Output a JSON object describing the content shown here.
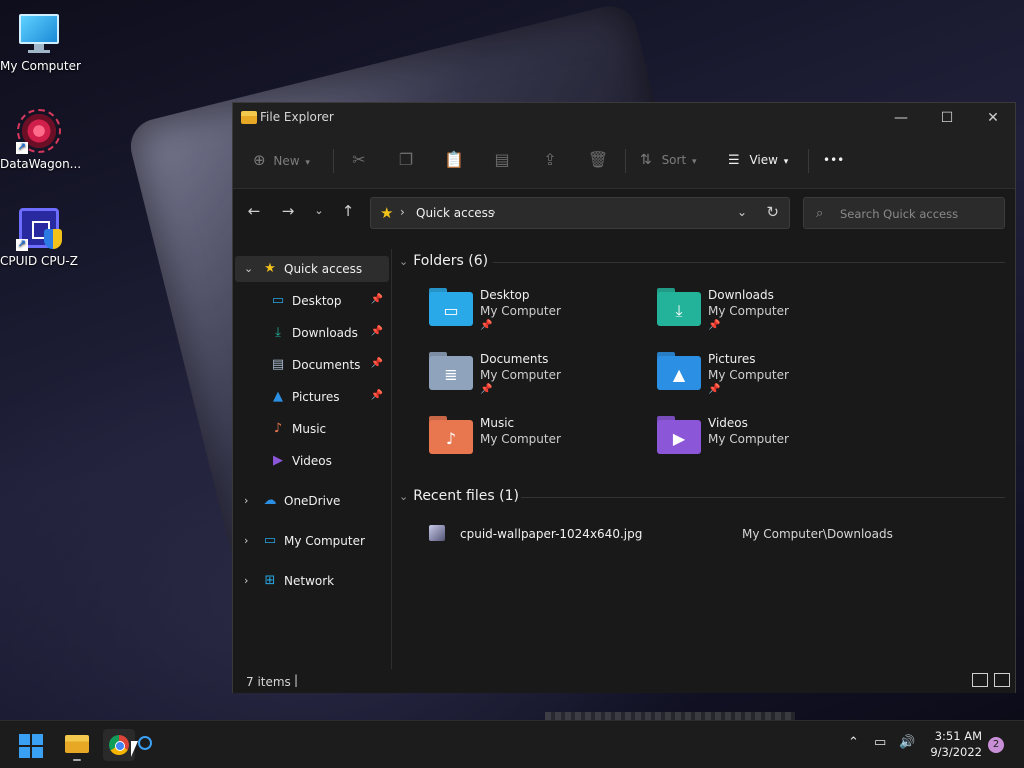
{
  "desktop": {
    "icons": [
      {
        "label": "My Computer"
      },
      {
        "label": "DataWagon..."
      },
      {
        "label": "CPUID CPU-Z"
      }
    ]
  },
  "window": {
    "title": "File Explorer",
    "controls": {
      "minimize": "—",
      "maximize": "☐",
      "close": "✕"
    }
  },
  "toolbar": {
    "new_label": "New",
    "sort_label": "Sort",
    "view_label": "View",
    "more_label": "•••"
  },
  "address": {
    "path_label": "Quick access",
    "search_placeholder": "Search Quick access"
  },
  "nav": {
    "items": [
      {
        "label": "Quick access"
      },
      {
        "label": "Desktop"
      },
      {
        "label": "Downloads"
      },
      {
        "label": "Documents"
      },
      {
        "label": "Pictures"
      },
      {
        "label": "Music"
      },
      {
        "label": "Videos"
      },
      {
        "label": "OneDrive"
      },
      {
        "label": "My Computer"
      },
      {
        "label": "Network"
      }
    ]
  },
  "content": {
    "folders_header": "Folders (6)",
    "folders": [
      {
        "name": "Desktop",
        "location": "My Computer",
        "color": "#29a9e8"
      },
      {
        "name": "Downloads",
        "location": "My Computer",
        "color": "#23b39a"
      },
      {
        "name": "Documents",
        "location": "My Computer",
        "color": "#8fa3bd"
      },
      {
        "name": "Pictures",
        "location": "My Computer",
        "color": "#2b8fe3"
      },
      {
        "name": "Music",
        "location": "My Computer",
        "color": "#e8764f"
      },
      {
        "name": "Videos",
        "location": "My Computer",
        "color": "#8b56d8"
      }
    ],
    "recent_header": "Recent files (1)",
    "recent_files": [
      {
        "name": "cpuid-wallpaper-1024x640.jpg",
        "location": "My Computer\\Downloads"
      }
    ]
  },
  "status": {
    "items_count": "7 items"
  },
  "taskbar": {
    "time": "3:51 AM",
    "date": "9/3/2022",
    "notifications": "2"
  }
}
